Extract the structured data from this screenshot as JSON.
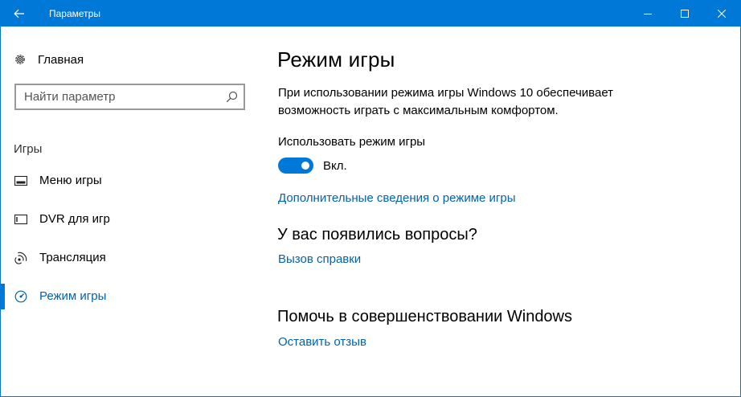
{
  "window": {
    "title": "Параметры",
    "accent": "#0078d7"
  },
  "titlebar": {
    "back_icon": "arrow-left-icon",
    "minimize_icon": "minimize-icon",
    "maximize_icon": "maximize-icon",
    "close_icon": "close-icon"
  },
  "sidebar": {
    "home_label": "Главная",
    "search_placeholder": "Найти параметр",
    "section_label": "Игры",
    "items": [
      {
        "label": "Меню игры",
        "icon": "game-bar-icon",
        "active": false
      },
      {
        "label": "DVR для игр",
        "icon": "game-dvr-icon",
        "active": false
      },
      {
        "label": "Трансляция",
        "icon": "broadcast-icon",
        "active": false
      },
      {
        "label": "Режим игры",
        "icon": "game-mode-icon",
        "active": true
      }
    ]
  },
  "main": {
    "title": "Режим игры",
    "description": "При использовании режима игры Windows 10 обеспечивает возможность играть с максимальным комфортом.",
    "toggle_label": "Использовать режим игры",
    "toggle_state": "Вкл.",
    "toggle_on": true,
    "more_info_link": "Дополнительные сведения о режиме игры",
    "questions_heading": "У вас появились вопросы?",
    "help_link": "Вызов справки",
    "improve_heading": "Помочь в совершенствовании Windows",
    "feedback_link": "Оставить отзыв"
  }
}
